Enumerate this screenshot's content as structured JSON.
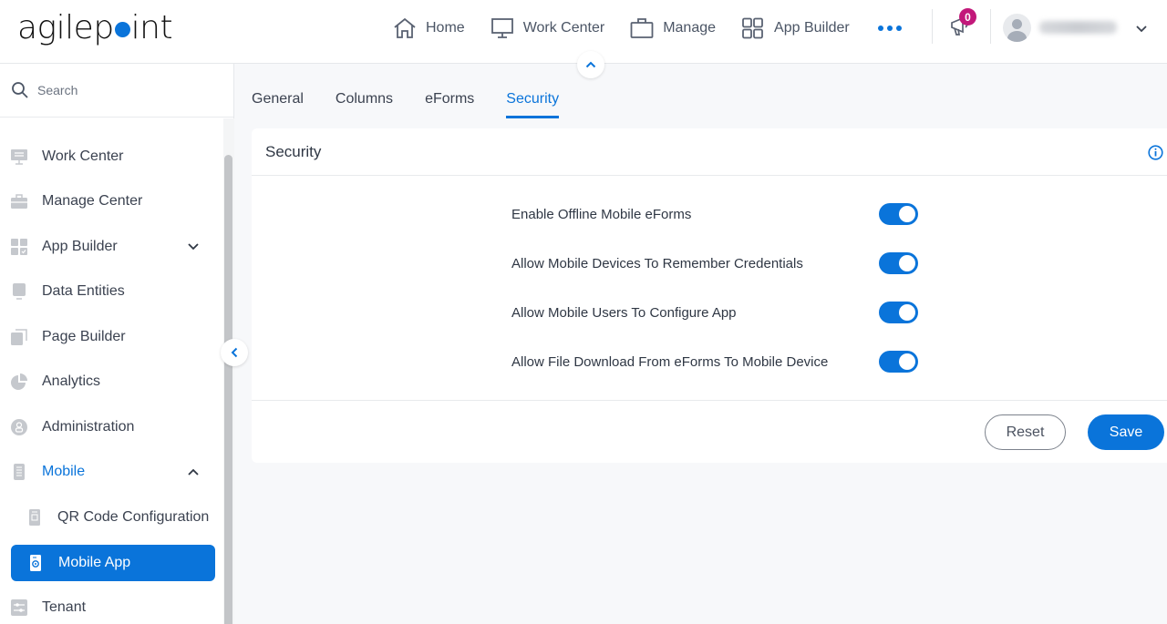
{
  "brand": {
    "logo_prefix": "agilep",
    "logo_suffix": "int",
    "accent": "#0a74da"
  },
  "topnav": {
    "items": [
      {
        "label": "Home",
        "icon": "home-icon"
      },
      {
        "label": "Work Center",
        "icon": "monitor-icon"
      },
      {
        "label": "Manage",
        "icon": "briefcase-icon"
      },
      {
        "label": "App Builder",
        "icon": "grid-icon"
      }
    ],
    "more_icon": "more-dots-icon",
    "notifications": {
      "count": "0",
      "icon": "megaphone-icon",
      "badge_color": "#c2187a"
    },
    "user": {
      "name_blurred": true
    }
  },
  "sidebar": {
    "search_placeholder": "Search",
    "items": [
      {
        "label": "Work Center",
        "icon": "work-center-icon"
      },
      {
        "label": "Manage Center",
        "icon": "toolbox-icon"
      },
      {
        "label": "App Builder",
        "icon": "app-builder-icon",
        "expandable": true,
        "expanded": false
      },
      {
        "label": "Data Entities",
        "icon": "data-entities-icon"
      },
      {
        "label": "Page Builder",
        "icon": "page-builder-icon"
      },
      {
        "label": "Analytics",
        "icon": "pie-chart-icon"
      },
      {
        "label": "Administration",
        "icon": "administration-icon"
      },
      {
        "label": "Mobile",
        "icon": "mobile-icon",
        "expandable": true,
        "expanded": true
      },
      {
        "label": "QR Code Configuration",
        "icon": "qr-code-icon",
        "sub": true
      },
      {
        "label": "Mobile App",
        "icon": "mobile-app-icon",
        "sub": true,
        "active": true
      },
      {
        "label": "Tenant",
        "icon": "tenant-icon"
      }
    ]
  },
  "tabs": [
    {
      "label": "General",
      "active": false
    },
    {
      "label": "Columns",
      "active": false
    },
    {
      "label": "eForms",
      "active": false
    },
    {
      "label": "Security",
      "active": true
    }
  ],
  "card": {
    "title": "Security",
    "settings": [
      {
        "label": "Enable Offline Mobile eForms",
        "enabled": true
      },
      {
        "label": "Allow Mobile Devices To Remember Credentials",
        "enabled": true
      },
      {
        "label": "Allow Mobile Users To Configure App",
        "enabled": true
      },
      {
        "label": "Allow File Download From eForms To Mobile Device",
        "enabled": true
      }
    ],
    "reset_label": "Reset",
    "save_label": "Save"
  }
}
